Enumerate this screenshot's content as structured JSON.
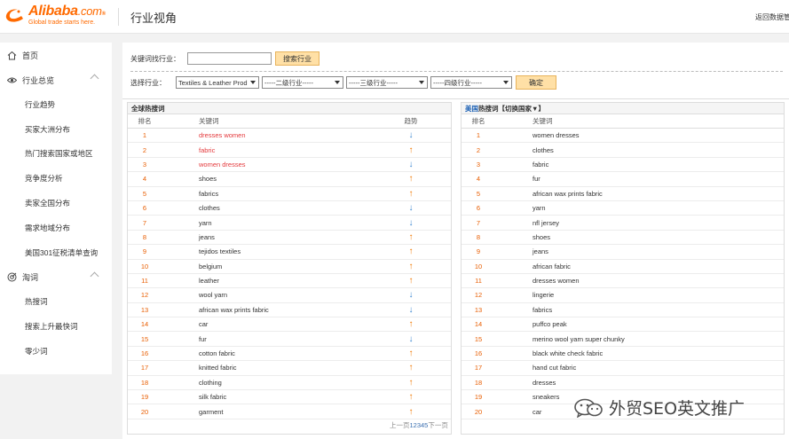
{
  "header": {
    "logo_text": "Alibaba",
    "logo_domain": ".com",
    "logo_tagline": "Global trade starts here.",
    "logo_trademark": "®",
    "title": "行业视角",
    "back_link": "返回数据管家"
  },
  "sidebar": {
    "groups": [
      {
        "label": "首页",
        "icon": "home-icon"
      },
      {
        "label": "行业总览",
        "icon": "eye-icon"
      },
      {
        "label": "淘词",
        "icon": "target-icon"
      }
    ],
    "overview_items": [
      "行业趋势",
      "买家大洲分布",
      "热门搜索国家或地区",
      "竞争度分析",
      "卖家全国分布",
      "需求地域分布",
      "美国301征税清单查询"
    ],
    "taoci_items": [
      "热搜词",
      "搜索上升最快词",
      "零少词"
    ]
  },
  "filters": {
    "keyword_label": "关键词找行业：",
    "keyword_value": "",
    "search_button": "搜索行业",
    "industry_label": "选择行业：",
    "level1": "Textiles & Leather Prod",
    "level2": "-----二级行业-----",
    "level3": "-----三级行业-----",
    "level4": "-----四级行业-----",
    "confirm_button": "确定"
  },
  "global_table": {
    "title": "全球热搜词",
    "headers": {
      "rank": "排名",
      "keyword": "关键词",
      "trend": "趋势"
    },
    "rows": [
      {
        "rank": "1",
        "keyword": "dresses women",
        "trend": "down",
        "red": true
      },
      {
        "rank": "2",
        "keyword": "fabric",
        "trend": "up",
        "red": true
      },
      {
        "rank": "3",
        "keyword": "women dresses",
        "trend": "down",
        "red": true
      },
      {
        "rank": "4",
        "keyword": "shoes",
        "trend": "up",
        "red": false
      },
      {
        "rank": "5",
        "keyword": "fabrics",
        "trend": "up",
        "red": false
      },
      {
        "rank": "6",
        "keyword": "clothes",
        "trend": "down",
        "red": false
      },
      {
        "rank": "7",
        "keyword": "yarn",
        "trend": "down",
        "red": false
      },
      {
        "rank": "8",
        "keyword": "jeans",
        "trend": "up",
        "red": false
      },
      {
        "rank": "9",
        "keyword": "tejidos textiles",
        "trend": "up",
        "red": false
      },
      {
        "rank": "10",
        "keyword": "belgium",
        "trend": "up",
        "red": false
      },
      {
        "rank": "11",
        "keyword": "leather",
        "trend": "up",
        "red": false
      },
      {
        "rank": "12",
        "keyword": "wool yarn",
        "trend": "down",
        "red": false
      },
      {
        "rank": "13",
        "keyword": "african wax prints fabric",
        "trend": "down",
        "red": false
      },
      {
        "rank": "14",
        "keyword": "car",
        "trend": "up",
        "red": false
      },
      {
        "rank": "15",
        "keyword": "fur",
        "trend": "down",
        "red": false
      },
      {
        "rank": "16",
        "keyword": "cotton fabric",
        "trend": "up",
        "red": false
      },
      {
        "rank": "17",
        "keyword": "knitted fabric",
        "trend": "up",
        "red": false
      },
      {
        "rank": "18",
        "keyword": "clothing",
        "trend": "up",
        "red": false
      },
      {
        "rank": "19",
        "keyword": "silk fabric",
        "trend": "up",
        "red": false
      },
      {
        "rank": "20",
        "keyword": "garment",
        "trend": "up",
        "red": false
      }
    ],
    "pager": {
      "prev": "上一页",
      "pages": "12345",
      "next": "下一页"
    }
  },
  "country_table": {
    "country": "美国",
    "title_rest": "热搜词【切换国家▼】",
    "headers": {
      "rank": "排名",
      "keyword": "关键词"
    },
    "rows": [
      {
        "rank": "1",
        "keyword": "women dresses"
      },
      {
        "rank": "2",
        "keyword": "clothes"
      },
      {
        "rank": "3",
        "keyword": "fabric"
      },
      {
        "rank": "4",
        "keyword": "fur"
      },
      {
        "rank": "5",
        "keyword": "african wax prints fabric"
      },
      {
        "rank": "6",
        "keyword": "yarn"
      },
      {
        "rank": "7",
        "keyword": "nfl jersey"
      },
      {
        "rank": "8",
        "keyword": "shoes"
      },
      {
        "rank": "9",
        "keyword": "jeans"
      },
      {
        "rank": "10",
        "keyword": "african fabric"
      },
      {
        "rank": "11",
        "keyword": "dresses women"
      },
      {
        "rank": "12",
        "keyword": "lingerie"
      },
      {
        "rank": "13",
        "keyword": "fabrics"
      },
      {
        "rank": "14",
        "keyword": "puffco peak"
      },
      {
        "rank": "15",
        "keyword": "merino wool yarn super chunky"
      },
      {
        "rank": "16",
        "keyword": "black white check fabric"
      },
      {
        "rank": "17",
        "keyword": "hand cut fabric"
      },
      {
        "rank": "18",
        "keyword": "dresses"
      },
      {
        "rank": "19",
        "keyword": "sneakers"
      },
      {
        "rank": "20",
        "keyword": "car"
      }
    ]
  },
  "watermark": {
    "text": "外贸SEO英文推广",
    "icon": "wechat-icon"
  },
  "colors": {
    "brand": "#ff6a00",
    "trend_up": "#f07800",
    "trend_down": "#3a86d0",
    "keyword_highlight": "#e4393c",
    "button_bg": "#ffe0a6"
  }
}
